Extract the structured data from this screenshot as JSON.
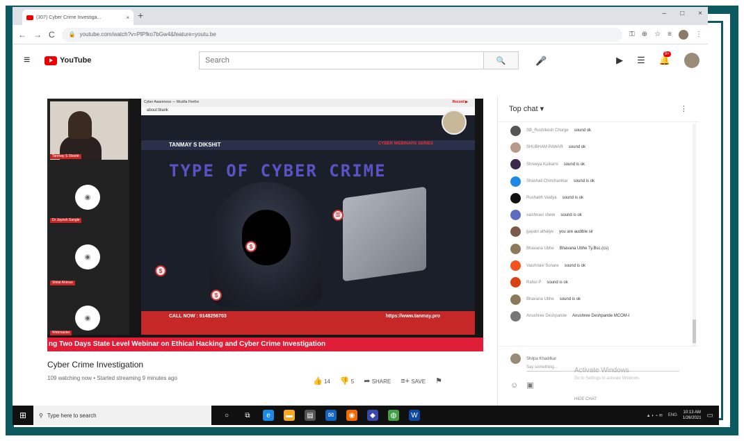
{
  "browser": {
    "tab_title": "(307) Cyber Crime Investiga...",
    "tab_close": "×",
    "new_tab": "+",
    "url": "youtube.com/watch?v=PlPfko7bGw4&feature=youtu.be",
    "min": "–",
    "max": "□",
    "close": "×"
  },
  "youtube": {
    "logo_text": "YouTube",
    "search_placeholder": "Search",
    "notif_count": "9+"
  },
  "video": {
    "ff_title": "Cyber Awareness — Mozilla Firefox",
    "ff_rec": "Record ▶",
    "ff_url": "about:blank",
    "presenter": "TANMAY S DIKSHIT",
    "series": "CYBER WEBINARS SERIES",
    "slide_title": "TYPE OF CYBER CRIME",
    "callnow": "CALL NOW : 9148256703",
    "site": "https://www.tanmay.pro",
    "ticker": "ng Two Days State Level Webinar on Ethical Hacking and Cyber Crime Investigation",
    "participants": [
      "Tanmay S Dikshit",
      "Dr Jayesh Sangle",
      "Shital Ahirrao",
      "Webmaster"
    ]
  },
  "title": "Cyber Crime Investigation",
  "meta": "109 watching now • Started streaming 9 minutes ago",
  "actions": {
    "likes": "14",
    "dislikes": "5",
    "share": "SHARE",
    "save": "SAVE"
  },
  "chat": {
    "header": "Top chat ▾",
    "messages": [
      {
        "author": "SB_Rushikesh Chorge",
        "text": "sound ok",
        "color": "#555"
      },
      {
        "author": "SHUBHAM PAWAR",
        "text": "sound ok",
        "color": "#b89a8a"
      },
      {
        "author": "Shreeya Kulkarni",
        "text": "sound is ok",
        "color": "#3a2a4a"
      },
      {
        "author": "Shashali Chinchanikar",
        "text": "sound is ok",
        "color": "#1e88e5"
      },
      {
        "author": "Rushabh Vaidya",
        "text": "sound is ok",
        "color": "#111"
      },
      {
        "author": "vaishnavi shete",
        "text": "sound is ok",
        "color": "#5c6bc0"
      },
      {
        "author": "gayatri athalye",
        "text": "you are audible sir",
        "color": "#7a5a4a"
      },
      {
        "author": "Bhavana Ubhe",
        "text": "Bhavana Ubhe Ty.Bsc.(cs)",
        "color": "#8a7a5a"
      },
      {
        "author": "Vaishnavi Sonare",
        "text": "sound is ok",
        "color": "#f4511e"
      },
      {
        "author": "Rahul P",
        "text": "sound is ok",
        "color": "#d84315"
      },
      {
        "author": "Bhavana Ubhe",
        "text": "sound is ok",
        "color": "#8a7a5a"
      },
      {
        "author": "Anushree Deshpande",
        "text": "Anushree Deshpande MCOM-I",
        "color": "#777"
      }
    ],
    "input_user": "Shilpa Khadilkar",
    "input_placeholder": "Say something...",
    "activate_title": "Activate Windows",
    "activate_sub": "Go to Settings to activate Windows.",
    "hide_chat": "HIDE CHAT"
  },
  "taskbar": {
    "search": "Type here to search",
    "time": "10:13 AM",
    "date": "1/26/2021",
    "lang": "ENG"
  }
}
